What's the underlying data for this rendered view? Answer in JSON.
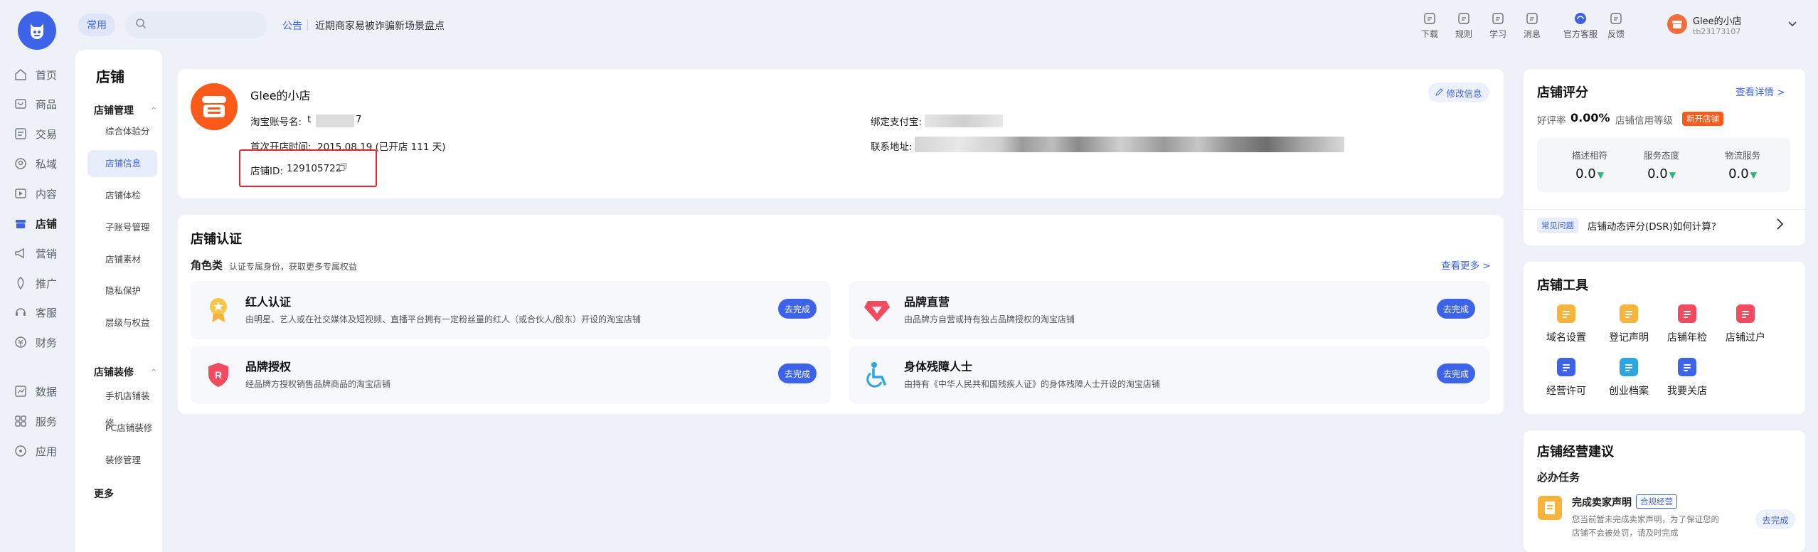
{
  "rail": {
    "items": [
      {
        "label": "首页",
        "icon": "home-icon"
      },
      {
        "label": "商品",
        "icon": "goods-icon"
      },
      {
        "label": "交易",
        "icon": "trade-icon"
      },
      {
        "label": "私域",
        "icon": "private-domain-icon"
      },
      {
        "label": "内容",
        "icon": "content-icon"
      },
      {
        "label": "店铺",
        "icon": "store-icon"
      },
      {
        "label": "营销",
        "icon": "marketing-icon"
      },
      {
        "label": "推广",
        "icon": "promotion-icon"
      },
      {
        "label": "客服",
        "icon": "customer-service-icon"
      },
      {
        "label": "财务",
        "icon": "finance-icon"
      },
      {
        "label": "数据",
        "icon": "data-icon"
      },
      {
        "label": "服务",
        "icon": "service-icon"
      },
      {
        "label": "应用",
        "icon": "apps-icon"
      }
    ]
  },
  "header": {
    "common_label": "常用",
    "search_placeholder": "",
    "notice_tag": "公告",
    "notice_text": "近期商家易被诈骗新场景盘点",
    "actions": [
      {
        "label": "下载",
        "icon": "download-icon"
      },
      {
        "label": "规则",
        "icon": "rules-icon"
      },
      {
        "label": "学习",
        "icon": "learn-icon"
      },
      {
        "label": "消息",
        "icon": "message-icon"
      },
      {
        "label": "官方客服",
        "icon": "official-support-icon"
      },
      {
        "label": "反馈",
        "icon": "feedback-icon"
      }
    ],
    "user_name": "Glee的小店",
    "user_id": "tb23173107"
  },
  "subnav": {
    "title": "店铺",
    "group1": "店铺管理",
    "group1_items": [
      "综合体验分",
      "店铺信息",
      "店铺体检",
      "子账号管理",
      "店铺素材",
      "隐私保护",
      "层级与权益"
    ],
    "group2": "店铺装修",
    "group2_items": [
      "手机店铺装修",
      "PC店铺装修",
      "装修管理"
    ],
    "more": "更多"
  },
  "shop_info": {
    "name": "Glee的小店",
    "account_label": "淘宝账号名:",
    "account_value_start": "t",
    "account_value_end": "7",
    "open_time_label": "首次开店时间:",
    "open_time_value": "2015.08.19 (已开店 111 天)",
    "shop_id_label": "店铺ID:",
    "shop_id_value": "129105722",
    "alipay_label": "绑定支付宝:",
    "address_label": "联系地址:",
    "edit_label": "修改信息"
  },
  "certification": {
    "title": "店铺认证",
    "category": "角色类",
    "category_desc": "认证专属身份，获取更多专属权益",
    "more": "查看更多 >",
    "items": [
      {
        "title": "红人认证",
        "desc": "由明星、艺人或在社交媒体及短视频、直播平台拥有一定粉丝量的红人（或合伙人/股东）开设的淘宝店铺",
        "btn": "去完成"
      },
      {
        "title": "品牌直营",
        "desc": "由品牌方自营或持有独占品牌授权的淘宝店铺",
        "btn": "去完成"
      },
      {
        "title": "品牌授权",
        "desc": "经品牌方授权销售品牌商品的淘宝店铺",
        "btn": "去完成"
      },
      {
        "title": "身体残障人士",
        "desc": "由持有《中华人民共和国残疾人证》的身体残障人士开设的淘宝店铺",
        "btn": "去完成"
      }
    ]
  },
  "rating": {
    "title": "店铺评分",
    "detail_link": "查看详情 >",
    "good_rate_label": "好评率",
    "good_rate_value": "0.00%",
    "credit_label": "店铺信用等级",
    "credit_badge": "新开店铺",
    "dsr": [
      {
        "label": "描述相符",
        "value": "0.0"
      },
      {
        "label": "服务态度",
        "value": "0.0"
      },
      {
        "label": "物流服务",
        "value": "0.0"
      }
    ],
    "faq_tag": "常见问题",
    "faq_text": "店铺动态评分(DSR)如何计算?"
  },
  "tools": {
    "title": "店铺工具",
    "items": [
      {
        "label": "域名设置",
        "icon": "domain-icon",
        "color": "#f6b53a"
      },
      {
        "label": "登记声明",
        "icon": "register-icon",
        "color": "#f6b53a"
      },
      {
        "label": "店铺年检",
        "icon": "annual-check-icon",
        "color": "#f24a5e"
      },
      {
        "label": "店铺过户",
        "icon": "transfer-icon",
        "color": "#f24a5e"
      },
      {
        "label": "经营许可",
        "icon": "license-icon",
        "color": "#3d63e8"
      },
      {
        "label": "创业档案",
        "icon": "archive-icon",
        "color": "#2da6e0"
      },
      {
        "label": "我要关店",
        "icon": "close-shop-icon",
        "color": "#3d63e8"
      }
    ]
  },
  "advice": {
    "title": "店铺经营建议",
    "subtitle": "必办任务",
    "task_title": "完成卖家声明",
    "task_tag": "合规经营",
    "task_desc1": "您当前暂未完成卖家声明，为了保证您的",
    "task_desc2": "店铺不会被处罚，请及时完成",
    "task_btn": "去完成"
  }
}
